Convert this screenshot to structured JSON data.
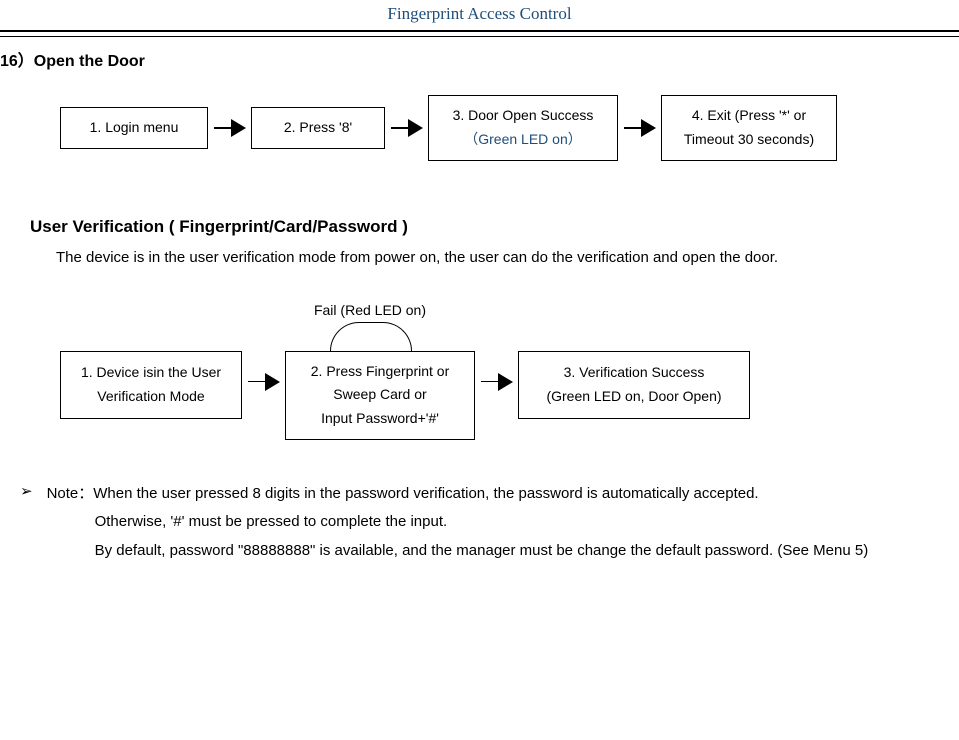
{
  "header": {
    "title": "Fingerprint Access Control"
  },
  "section1": {
    "title": "16）Open the Door",
    "step1": "1. Login menu",
    "step2": "2. Press '8'",
    "step3_line1": "3. Door Open Success",
    "step3_line2": "（Green LED on）",
    "step4_line1": "4. Exit (Press '*' or",
    "step4_line2": "Timeout 30 seconds)"
  },
  "section2": {
    "heading": "User Verification ( Fingerprint/Card/Password )",
    "body": "The device is in the user verification mode from power on, the user can do the verification and open the door.",
    "fail_label": "Fail (Red LED on)",
    "step1_line1": "1. Device isin the User",
    "step1_line2": "Verification Mode",
    "step2_line1": "2. Press Fingerprint or",
    "step2_line2": "Sweep Card or",
    "step2_line3": "Input Password+'#'",
    "step3_line1": "3. Verification Success",
    "step3_line2": "(Green LED on, Door Open)"
  },
  "note": {
    "bullet": "➢",
    "line1": "Note：When the user pressed 8 digits in the password verification, the password is automatically accepted.",
    "line2": "Otherwise, '#' must be pressed to complete the input.",
    "line3": "By default, password \"88888888\" is available, and the manager must be change the default password. (See Menu 5)"
  }
}
